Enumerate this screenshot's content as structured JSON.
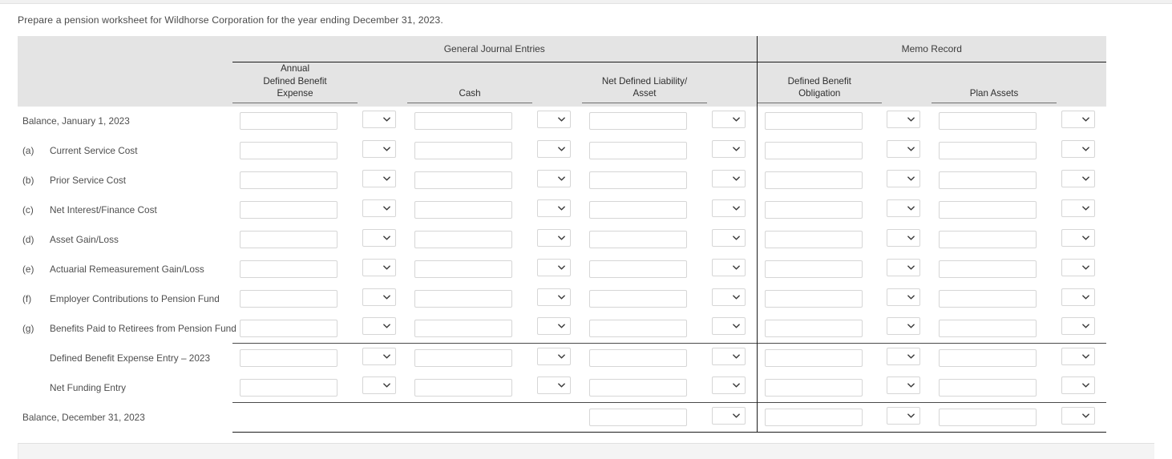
{
  "instruction": "Prepare a pension worksheet for Wildhorse Corporation for the year ending December 31, 2023.",
  "groups": {
    "general": "General Journal Entries",
    "memo": "Memo Record"
  },
  "columns": [
    {
      "key": "annual_expense",
      "label_lines": [
        "Annual",
        "Defined Benefit",
        "Expense"
      ],
      "group": "general"
    },
    {
      "key": "cash",
      "label_lines": [
        "Cash"
      ],
      "group": "general"
    },
    {
      "key": "net_defined",
      "label_lines": [
        "Net Defined Liability/",
        "Asset"
      ],
      "group": "general"
    },
    {
      "key": "dbo",
      "label_lines": [
        "Defined Benefit",
        "Obligation"
      ],
      "group": "memo"
    },
    {
      "key": "plan_assets",
      "label_lines": [
        "Plan Assets"
      ],
      "group": "memo"
    }
  ],
  "rows": [
    {
      "marker": "",
      "label": "Balance, January 1, 2023",
      "indent": false,
      "cells": [
        1,
        1,
        1,
        1,
        1
      ]
    },
    {
      "marker": "(a)",
      "label": "Current Service Cost",
      "indent": true,
      "cells": [
        1,
        1,
        1,
        1,
        1
      ]
    },
    {
      "marker": "(b)",
      "label": "Prior Service Cost",
      "indent": true,
      "cells": [
        1,
        1,
        1,
        1,
        1
      ]
    },
    {
      "marker": "(c)",
      "label": "Net Interest/Finance Cost",
      "indent": true,
      "cells": [
        1,
        1,
        1,
        1,
        1
      ]
    },
    {
      "marker": "(d)",
      "label": "Asset Gain/Loss",
      "indent": true,
      "cells": [
        1,
        1,
        1,
        1,
        1
      ]
    },
    {
      "marker": "(e)",
      "label": "Actuarial Remeasurement Gain/Loss",
      "indent": true,
      "cells": [
        1,
        1,
        1,
        1,
        1
      ]
    },
    {
      "marker": "(f)",
      "label": "Employer Contributions to Pension Fund",
      "indent": true,
      "cells": [
        1,
        1,
        1,
        1,
        1
      ]
    },
    {
      "marker": "(g)",
      "label": "Benefits Paid to Retirees from Pension Fund",
      "indent": true,
      "cells": [
        1,
        1,
        1,
        1,
        1
      ]
    },
    {
      "marker": "",
      "label": "Defined Benefit Expense Entry – 2023",
      "indent": true,
      "cells": [
        1,
        1,
        1,
        1,
        1
      ]
    },
    {
      "marker": "",
      "label": "Net Funding Entry",
      "indent": true,
      "cells": [
        1,
        1,
        1,
        1,
        1
      ]
    },
    {
      "marker": "",
      "label": "Balance, December 31, 2023",
      "indent": false,
      "cells": [
        0,
        0,
        1,
        1,
        1
      ]
    }
  ],
  "field": {
    "amount_value": "",
    "amount_placeholder": "",
    "dropdown_value": "",
    "dropdown_icon": "chevron-down-icon"
  },
  "colors": {
    "header_bg": "#e4e4e4",
    "rule": "#4a4a4a",
    "divider": "#1b1b1b",
    "input_border": "#d6d6d6",
    "text": "#4e4e4e"
  }
}
